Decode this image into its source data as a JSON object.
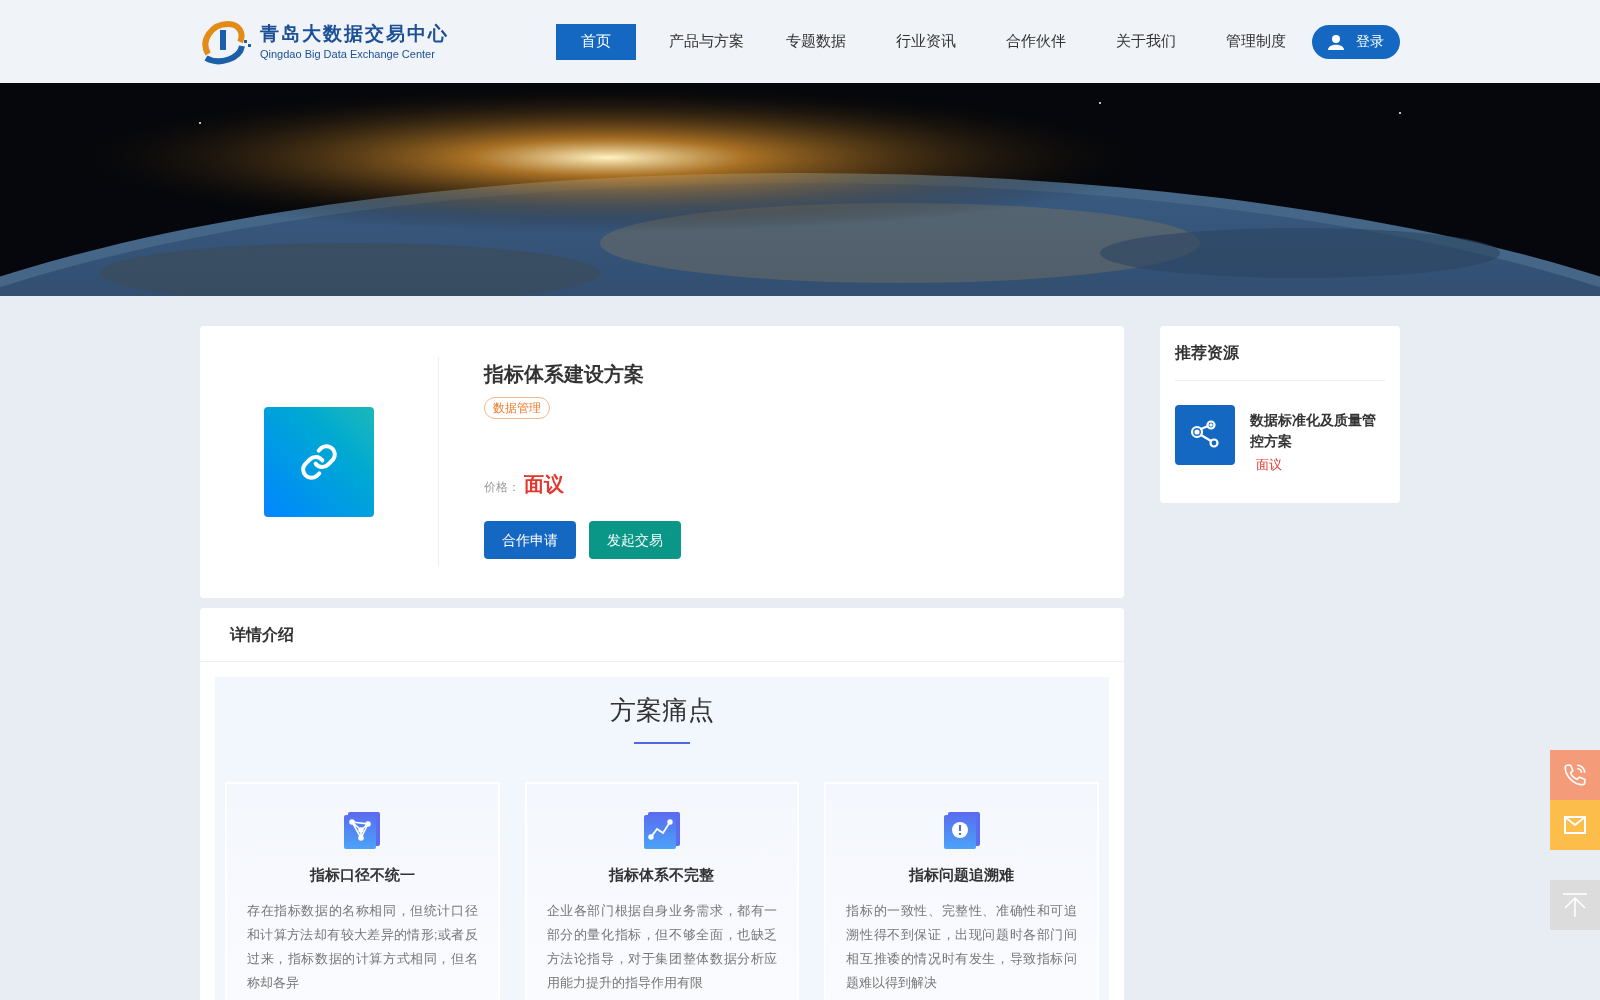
{
  "header": {
    "logo_title": "青岛大数据交易中心",
    "logo_subtitle": "Qingdao Big Data Exchange Center",
    "nav": [
      {
        "label": "首页",
        "selected": true
      },
      {
        "label": "产品与方案",
        "selected": false
      },
      {
        "label": "专题数据",
        "selected": false
      },
      {
        "label": "行业资讯",
        "selected": false
      },
      {
        "label": "合作伙伴",
        "selected": false
      },
      {
        "label": "关于我们",
        "selected": false
      },
      {
        "label": "管理制度",
        "selected": false
      }
    ],
    "login": "登录"
  },
  "product": {
    "title": "指标体系建设方案",
    "tag": "数据管理",
    "price_label": "价格：",
    "price": "面议",
    "buttons": [
      {
        "label": "合作申请",
        "kind": "primary"
      },
      {
        "label": "发起交易",
        "kind": "secondary"
      }
    ]
  },
  "details": {
    "heading": "详情介绍",
    "section_title": "方案痛点",
    "cards": [
      {
        "kind": "network",
        "title": "指标口径不统一",
        "text": "存在指标数据的名称相同，但统计口径和计算方法却有较大差异的情形;或者反过来，指标数据的计算方式相同，但名称却各异"
      },
      {
        "kind": "trend",
        "title": "指标体系不完整",
        "text": "企业各部门根据自身业务需求，都有一部分的量化指标，但不够全面，也缺乏方法论指导，对于集团整体数据分析应用能力提升的指导作用有限"
      },
      {
        "kind": "alert",
        "title": "指标问题追溯难",
        "text": "指标的一致性、完整性、准确性和可追溯性得不到保证，出现问题时各部门间相互推诿的情况时有发生，导致指标问题难以得到解决"
      }
    ]
  },
  "sidebar": {
    "title": "推荐资源",
    "items": [
      {
        "title": "数据标准化及质量管控方案",
        "price": "面议"
      }
    ]
  }
}
